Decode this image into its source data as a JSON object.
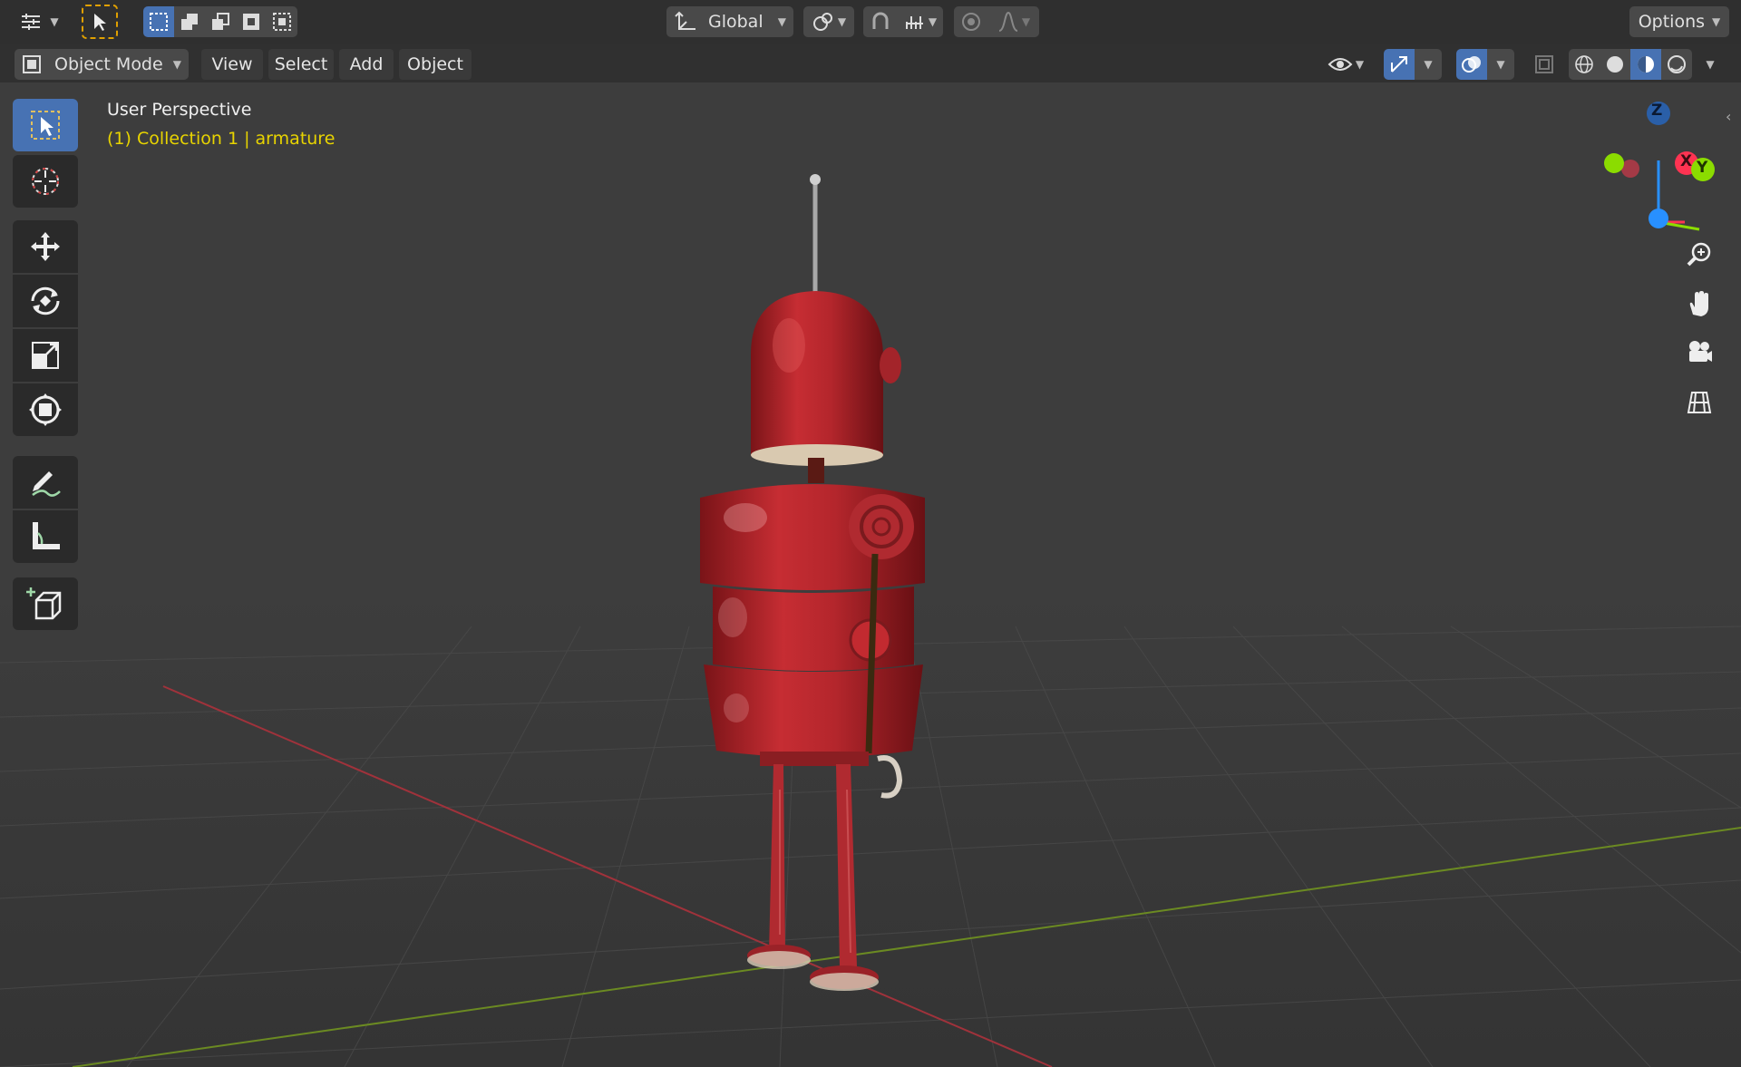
{
  "topbar": {
    "transform_orientation": "Global",
    "options_label": "Options"
  },
  "header": {
    "mode_label": "Object Mode",
    "menu": [
      "View",
      "Select",
      "Add",
      "Object"
    ]
  },
  "viewport": {
    "view_name": "User Perspective",
    "collection_info": "(1) Collection 1 | armature"
  },
  "gizmo": {
    "axis_z": "Z",
    "axis_x": "X",
    "axis_y": "Y"
  },
  "colors": {
    "accent": "#4772b3",
    "collection_text": "#e8d400",
    "axis_x": "#ff3352",
    "axis_y": "#8bdc00",
    "axis_z": "#2890ff",
    "robot_red": "#b5232a"
  },
  "toolbar_icons": [
    "select-box-icon",
    "cursor-icon",
    "move-icon",
    "rotate-icon",
    "scale-icon",
    "transform-icon",
    "annotate-icon",
    "measure-icon",
    "add-cube-icon"
  ],
  "nav_icons": [
    "zoom-icon",
    "pan-hand-icon",
    "camera-icon",
    "grid-icon"
  ]
}
